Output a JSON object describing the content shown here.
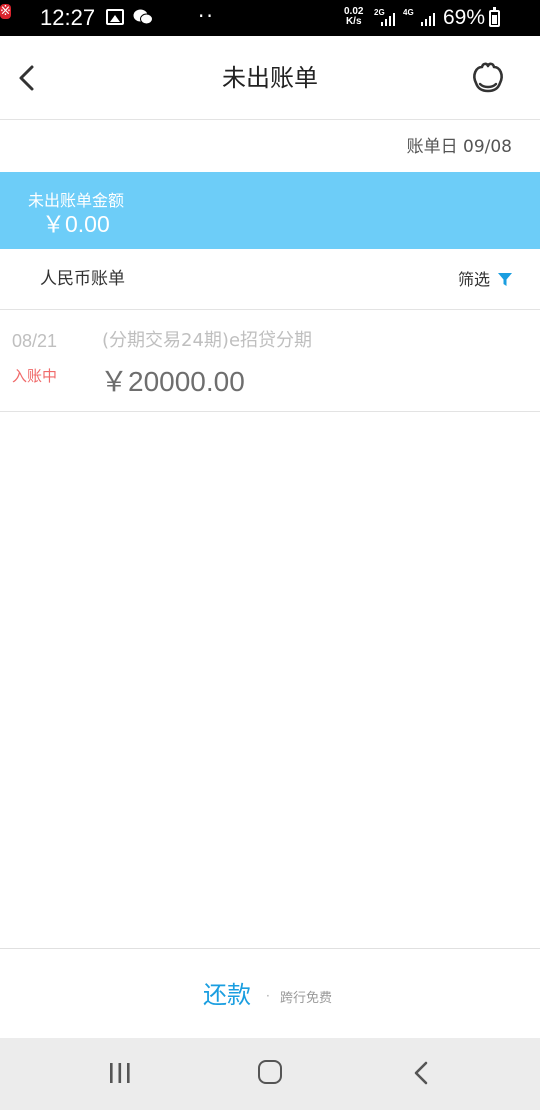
{
  "status_bar": {
    "time": "12:27",
    "speed": "0.02",
    "speed_unit": "K/s",
    "net1": "2G",
    "net2": "4G",
    "battery": "69%",
    "app_glyph": "※"
  },
  "header": {
    "title": "未出账单",
    "back_icon": "chevron-left-icon",
    "service_icon": "customer-service-icon"
  },
  "bill_date": "账单日 09/08",
  "summary": {
    "label": "未出账单金额",
    "amount": "￥0.00",
    "bg_color": "#6dcdf8"
  },
  "currency_tab": {
    "label": "人民币账单",
    "filter_label": "筛选",
    "filter_icon": "filter-icon",
    "accent": "#1a9ee0"
  },
  "transactions": [
    {
      "date": "08/21",
      "status": "入账中",
      "description": "(分期交易24期)e招贷分期",
      "amount": "￥20000.00"
    }
  ],
  "bottom_action": {
    "repay_label": "还款",
    "note": "跨行免费"
  },
  "nav_bar": {
    "recent_icon": "recent-apps-icon",
    "home_icon": "home-icon",
    "back_icon": "back-icon"
  }
}
